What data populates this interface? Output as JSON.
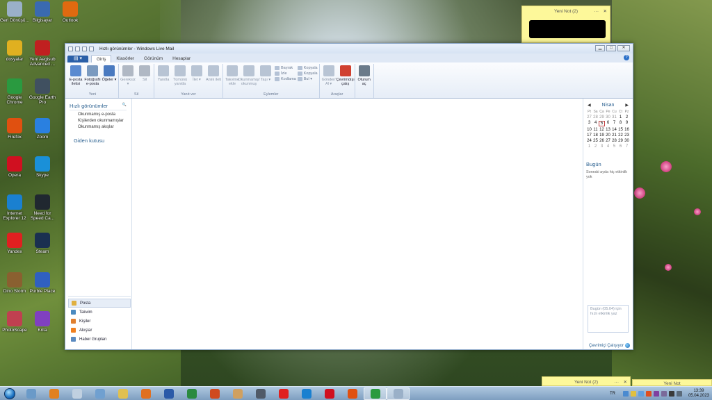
{
  "desktop_icons": [
    {
      "label": "Geri Dönüşü...",
      "color": "#9ab0c8"
    },
    {
      "label": "Bilgisayar",
      "color": "#3a6ab0"
    },
    {
      "label": "Outlook",
      "color": "#e06a10"
    },
    {
      "label": "dosyalar",
      "color": "#e0b020"
    },
    {
      "label": "Yeni Aegisub Advanced ...",
      "color": "#c02020"
    },
    {
      "label": "Google Chrome",
      "color": "#2a9a40"
    },
    {
      "label": "Google Earth Pro",
      "color": "#405060"
    },
    {
      "label": "Firefox",
      "color": "#e05010"
    },
    {
      "label": "Zoom",
      "color": "#2a80e0"
    },
    {
      "label": "Opera",
      "color": "#d01020"
    },
    {
      "label": "Skype",
      "color": "#1a90d8"
    },
    {
      "label": "Internet Explorer 12",
      "color": "#1a80d0"
    },
    {
      "label": "Need for Speed Ca...",
      "color": "#202830"
    },
    {
      "label": "Yandex",
      "color": "#e02020"
    },
    {
      "label": "Steam",
      "color": "#1a3050"
    },
    {
      "label": "Dino Storm",
      "color": "#8a6030"
    },
    {
      "label": "Purble Place",
      "color": "#3060c0"
    },
    {
      "label": "PhotoScape",
      "color": "#c04050"
    },
    {
      "label": "Krita",
      "color": "#8040c0"
    }
  ],
  "sticky_notes": [
    {
      "title": "Yeni Not (2)",
      "dots": "···",
      "close": "✕"
    },
    {
      "title": "Yeni Not (2)",
      "dots": "···",
      "close": "✕"
    },
    {
      "title": "Yeni Not",
      "dots": "",
      "close": ""
    }
  ],
  "window": {
    "title": "Hızlı görünümler - Windows Live Mail",
    "buttons": {
      "min": "▁",
      "max": "□",
      "close": "✕"
    },
    "help": "?",
    "file_menu": "▤ ▾",
    "tabs": [
      "Giriş",
      "Klasörler",
      "Görünüm",
      "Hesaplar"
    ]
  },
  "ribbon": {
    "groups": [
      {
        "label": "Yeni",
        "buttons": [
          {
            "label": "E-posta iletisi",
            "color": "#5a8ad0",
            "disabled": false
          },
          {
            "label": "Fotoğraflı e-posta",
            "color": "#7a9ac0",
            "disabled": false
          },
          {
            "label": "Öğeler ▾",
            "color": "#4a7ac0",
            "disabled": false
          }
        ]
      },
      {
        "label": "Sil",
        "buttons": [
          {
            "label": "Gereksiz ▾",
            "color": "#b0b8c4",
            "disabled": true
          },
          {
            "label": "Sil",
            "color": "#b0b8c4",
            "disabled": true
          }
        ]
      },
      {
        "label": "Yanıt ver",
        "buttons": [
          {
            "label": "Yanıtla",
            "color": "#b8c4d4",
            "disabled": true
          },
          {
            "label": "Tümünü yanıtla",
            "color": "#b8c4d4",
            "disabled": true
          },
          {
            "label": "İlet ▾",
            "color": "#b8c4d4",
            "disabled": true
          },
          {
            "label": "Anlık ileti",
            "color": "#b8c4d4",
            "disabled": true
          }
        ]
      },
      {
        "label": "Eylemler",
        "buttons": [
          {
            "label": "Takvime ekle",
            "color": "#b8c4d4",
            "disabled": true
          },
          {
            "label": "Okunmamış/ okunmuş",
            "color": "#b8c4d4",
            "disabled": true
          },
          {
            "label": "Taşı ▾",
            "color": "#b8c4d4",
            "disabled": true
          }
        ],
        "small": [
          {
            "label": "Bayrak"
          },
          {
            "label": "İzle"
          },
          {
            "label": "Kodlama"
          },
          {
            "label": "Kopyala"
          },
          {
            "label": "Kopyala"
          },
          {
            "label": "Bul ▾"
          }
        ]
      },
      {
        "label": "Araçlar",
        "buttons": [
          {
            "label": "Gönder/ Al ▾",
            "color": "#b8c4d4",
            "disabled": true
          },
          {
            "label": "Çevrimdışı çalış",
            "color": "#d04030",
            "disabled": false
          }
        ]
      },
      {
        "label": "",
        "buttons": [
          {
            "label": "Oturum aç",
            "color": "#6a7a8a",
            "disabled": false
          }
        ]
      }
    ]
  },
  "nav": {
    "section_title": "Hızlı görünümler",
    "section_icon": "🔍",
    "items": [
      "Okunmamış e-posta",
      "Kişilerden okunmamışlar",
      "Okunmamış akışlar"
    ],
    "outbox": "Giden kutusu",
    "bottom": [
      {
        "label": "Posta",
        "color": "#e0b040",
        "selected": true
      },
      {
        "label": "Takvim",
        "color": "#4a8ac0",
        "selected": false
      },
      {
        "label": "Kişiler",
        "color": "#e08030",
        "selected": false
      },
      {
        "label": "Akışlar",
        "color": "#f08020",
        "selected": false
      },
      {
        "label": "Haber Grupları",
        "color": "#5a8ac0",
        "selected": false
      }
    ]
  },
  "calendar": {
    "prev": "◀",
    "next": "▶",
    "month": "Nisan",
    "day_names": [
      "Pt",
      "Sa",
      "Ça",
      "Pe",
      "Cu",
      "Ct",
      "Pz"
    ],
    "days": [
      [
        "27",
        "28",
        "29",
        "30",
        "31",
        "1",
        "2"
      ],
      [
        "3",
        "4",
        "5",
        "6",
        "7",
        "8",
        "9"
      ],
      [
        "10",
        "11",
        "12",
        "13",
        "14",
        "15",
        "16"
      ],
      [
        "17",
        "18",
        "19",
        "20",
        "21",
        "22",
        "23"
      ],
      [
        "24",
        "25",
        "26",
        "27",
        "28",
        "29",
        "30"
      ],
      [
        "1",
        "2",
        "3",
        "4",
        "5",
        "6",
        "7"
      ]
    ],
    "today": "Bugün",
    "no_events": "Sonraki ayda hiç etkinlik yok",
    "quick_event_placeholder": "Bugün (05.04) için hızlı etkinlik yaz"
  },
  "status": {
    "text": "Çevrimiçi Çalışıyor"
  },
  "taskbar": {
    "apps": [
      {
        "name": "start-orb"
      },
      {
        "name": "taskbar-app-1",
        "color": "#6a9ac8"
      },
      {
        "name": "taskbar-app-media",
        "color": "#e08020"
      },
      {
        "name": "taskbar-app-3",
        "color": "#c0d0e0"
      },
      {
        "name": "taskbar-app-4",
        "color": "#70a0d0"
      },
      {
        "name": "taskbar-app-folder",
        "color": "#e0c050"
      },
      {
        "name": "taskbar-app-outlook",
        "color": "#e07020"
      },
      {
        "name": "taskbar-app-word",
        "color": "#2a5aa8"
      },
      {
        "name": "taskbar-app-excel",
        "color": "#2a8a40"
      },
      {
        "name": "taskbar-app-powerpoint",
        "color": "#d04a20"
      },
      {
        "name": "taskbar-app-paint",
        "color": "#d0a060"
      },
      {
        "name": "taskbar-app-11",
        "color": "#505a68"
      },
      {
        "name": "taskbar-app-yandex",
        "color": "#e02020"
      },
      {
        "name": "taskbar-app-ie",
        "color": "#1a80d0"
      },
      {
        "name": "taskbar-app-opera",
        "color": "#d01020"
      },
      {
        "name": "taskbar-app-firefox",
        "color": "#e05010"
      },
      {
        "name": "taskbar-app-chrome",
        "color": "#2a9a40"
      },
      {
        "name": "taskbar-app-mail",
        "color": "#9ab0c8"
      }
    ],
    "lang": "TR",
    "time": "13:39",
    "date": "05.04.2023"
  }
}
